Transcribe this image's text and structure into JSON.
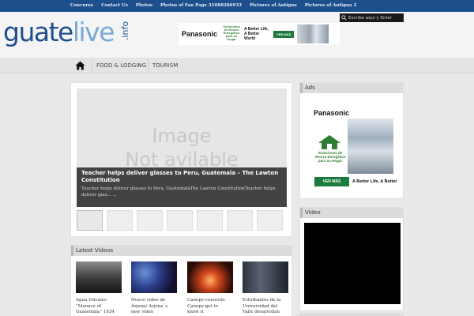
{
  "topnav": [
    "Concurso",
    "Contact Us",
    "Photos",
    "Photos of Fan Page 31088286933",
    "Pictures of Antigua",
    "Pictures of Antigua 2"
  ],
  "search": {
    "placeholder": "Escribe aquí y Enter"
  },
  "logo": {
    "part1": "guate",
    "part2": "live",
    "part3": ".info"
  },
  "banner_top": {
    "brand": "Panasonic",
    "green_text": "Soluciones de Ahorro Energético para su Hogar",
    "slogan": "A Better Life, A Better World",
    "button": "VER MÁS"
  },
  "nav": {
    "items": [
      "FOOD & LODGING",
      "TOURISM"
    ]
  },
  "slider": {
    "placeholder_line1": "Image",
    "placeholder_line2": "Not avilable",
    "title": "Teacher helps deliver glasses to Peru, Guatemala – The Lawton Constitution",
    "excerpt": "Teacher helps deliver glasses to Peru, GuatemalaThe Lawton ConstitutionTeacher helps deliver glas... ..."
  },
  "latest_videos": {
    "title": "Latest Videos",
    "items": [
      {
        "title": "Agua Volcano: “Menace of Guatemala” 1934"
      },
      {
        "title": "Nuevo video de Arjona/ Arjona´s new video"
      },
      {
        "title": "Canopy-conocelo. Canopy-get to know it"
      },
      {
        "title": "Estudiantes de la Universidad del Valle desarrollan mon..."
      }
    ]
  },
  "ads": {
    "title": "Ads",
    "brand": "Panasonic",
    "green_text": "Soluciones de Ahorro Energético para su Hogar",
    "button": "VER MÁS",
    "slogan": "A Better Life, A Better"
  },
  "video": {
    "title": "Video"
  },
  "colors": {
    "topbar": "#1d4f8c",
    "logo_dark": "#1d4f8c",
    "logo_light": "#7aa8d6",
    "ad_green": "#1b7a3d"
  },
  "icons": {
    "home": "home-icon",
    "search": "search-icon"
  }
}
